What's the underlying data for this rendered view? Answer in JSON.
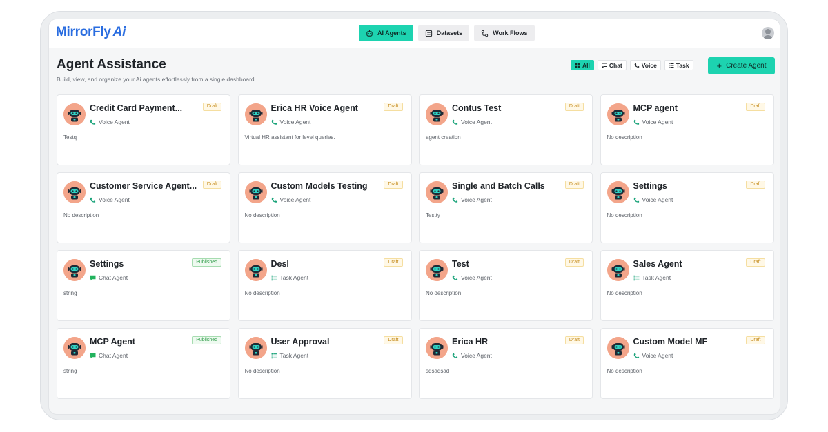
{
  "app": {
    "logo_main": "MirrorFly",
    "logo_suffix": "Ai"
  },
  "nav": [
    {
      "label": "AI Agents",
      "icon": "robot-icon",
      "active": true
    },
    {
      "label": "Datasets",
      "icon": "list-icon",
      "active": false
    },
    {
      "label": "Work Flows",
      "icon": "workflow-icon",
      "active": false
    }
  ],
  "page": {
    "title": "Agent Assistance",
    "subtitle": "Build, view, and organize your Ai agents effortlessly from a single dashboard."
  },
  "filters": [
    {
      "label": "All",
      "icon": "grid-icon",
      "active": true
    },
    {
      "label": "Chat",
      "icon": "chat-icon",
      "active": false
    },
    {
      "label": "Voice",
      "icon": "phone-icon",
      "active": false
    },
    {
      "label": "Task",
      "icon": "task-icon",
      "active": false
    }
  ],
  "create_button": {
    "label": "Create Agent"
  },
  "colors": {
    "accent": "#1dd3b0",
    "brand": "#2a6de0",
    "voice": "#1aa37a",
    "chat": "#22b35e",
    "task": "#1aa37a"
  },
  "agents": [
    {
      "name": "Credit Card Payment...",
      "status": "Draft",
      "type": "Voice Agent",
      "kind": "voice",
      "description": "Testq"
    },
    {
      "name": "Erica HR Voice Agent",
      "status": "Draft",
      "type": "Voice Agent",
      "kind": "voice",
      "description": "Virtual HR assistant for level queries."
    },
    {
      "name": "Contus Test",
      "status": "Draft",
      "type": "Voice Agent",
      "kind": "voice",
      "description": "agent creation"
    },
    {
      "name": "MCP agent",
      "status": "Draft",
      "type": "Voice Agent",
      "kind": "voice",
      "description": "No description"
    },
    {
      "name": "Customer Service Agent...",
      "status": "Draft",
      "type": "Voice Agent",
      "kind": "voice",
      "description": "No description"
    },
    {
      "name": "Custom Models Testing",
      "status": "Draft",
      "type": "Voice Agent",
      "kind": "voice",
      "description": "No description"
    },
    {
      "name": "Single and Batch Calls",
      "status": "Draft",
      "type": "Voice Agent",
      "kind": "voice",
      "description": "Testty"
    },
    {
      "name": "Settings",
      "status": "Draft",
      "type": "Voice Agent",
      "kind": "voice",
      "description": "No description"
    },
    {
      "name": "Settings",
      "status": "Published",
      "type": "Chat Agent",
      "kind": "chat",
      "description": "string"
    },
    {
      "name": "Desl",
      "status": "Draft",
      "type": "Task Agent",
      "kind": "task",
      "description": "No description"
    },
    {
      "name": "Test",
      "status": "Draft",
      "type": "Voice Agent",
      "kind": "voice",
      "description": "No description"
    },
    {
      "name": "Sales Agent",
      "status": "Draft",
      "type": "Task Agent",
      "kind": "task",
      "description": "No description"
    },
    {
      "name": "MCP Agent",
      "status": "Published",
      "type": "Chat Agent",
      "kind": "chat",
      "description": "string"
    },
    {
      "name": "User Approval",
      "status": "Draft",
      "type": "Task Agent",
      "kind": "task",
      "description": "No description"
    },
    {
      "name": "Erica HR",
      "status": "Draft",
      "type": "Voice Agent",
      "kind": "voice",
      "description": "sdsadsad"
    },
    {
      "name": "Custom Model MF",
      "status": "Draft",
      "type": "Voice Agent",
      "kind": "voice",
      "description": "No description"
    }
  ]
}
